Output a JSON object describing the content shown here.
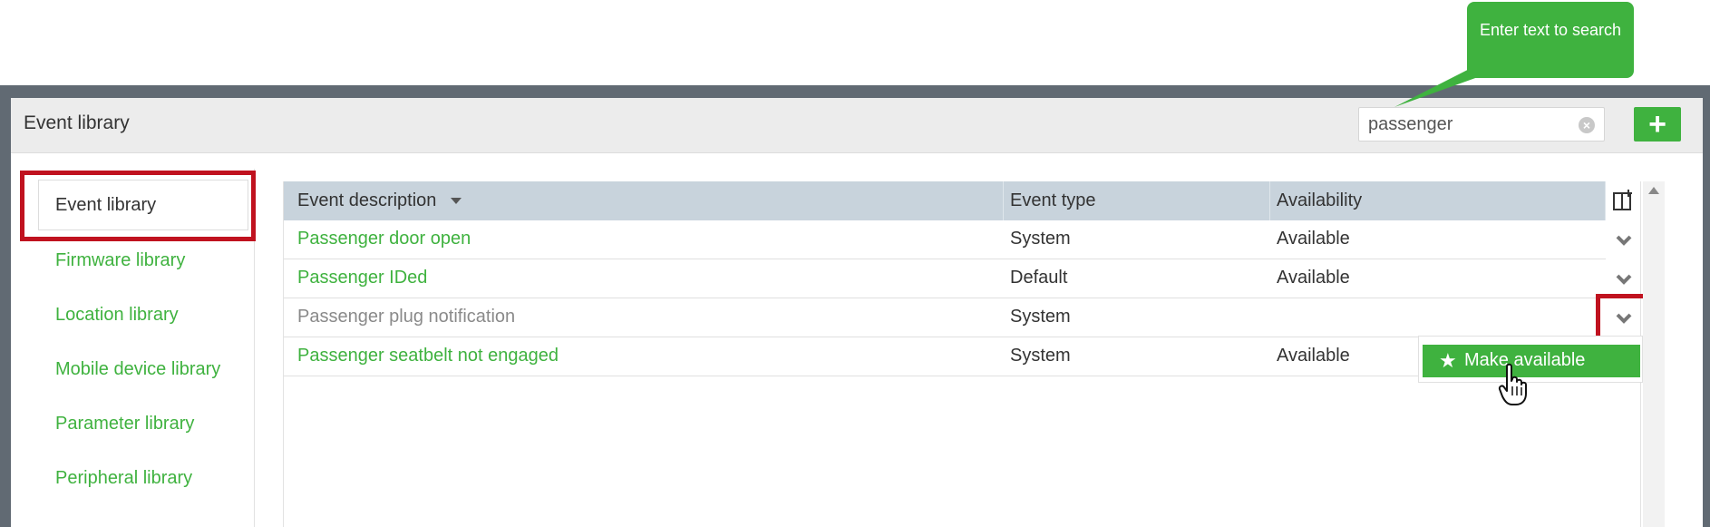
{
  "tooltip": {
    "text": "Enter text to search"
  },
  "header": {
    "title": "Event library"
  },
  "search": {
    "value": "passenger",
    "clear_icon": "clear-circle-icon"
  },
  "add_button": {
    "icon": "plus-icon"
  },
  "sidebar": {
    "items": [
      {
        "label": "Event library",
        "active": true
      },
      {
        "label": "Firmware library"
      },
      {
        "label": "Location library"
      },
      {
        "label": "Mobile device library"
      },
      {
        "label": "Parameter library"
      },
      {
        "label": "Peripheral library"
      }
    ]
  },
  "table": {
    "columns": [
      "Event description",
      "Event type",
      "Availability"
    ],
    "rows": [
      {
        "description": "Passenger door open",
        "type": "System",
        "availability": "Available"
      },
      {
        "description": "Passenger IDed",
        "type": "Default",
        "availability": "Available"
      },
      {
        "description": "Passenger plug notification",
        "type": "System",
        "availability": ""
      },
      {
        "description": "Passenger seatbelt not engaged",
        "type": "System",
        "availability": "Available"
      }
    ]
  },
  "context_menu": {
    "make_available": "Make available"
  },
  "colors": {
    "accent": "#3fb23f",
    "highlight": "#c0121f",
    "header_bg": "#c8d3dc"
  }
}
